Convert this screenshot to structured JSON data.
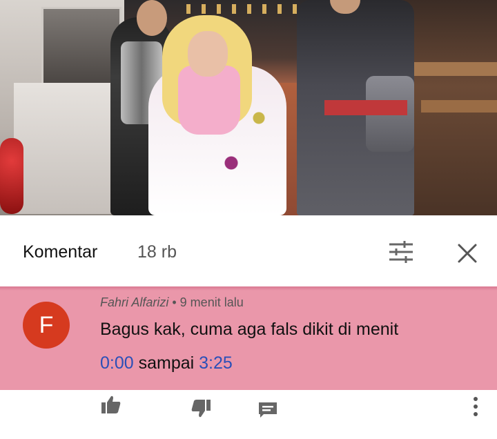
{
  "comments_panel": {
    "title": "Komentar",
    "count": "18 rb"
  },
  "comment": {
    "avatar_letter": "F",
    "avatar_color": "#d63a1f",
    "highlight_color": "#ea97aa",
    "author": "Fahri Alfarizi",
    "separator": " • ",
    "time": "9 menit lalu",
    "text_line1": "Bagus kak, cuma aga fals dikit di menit",
    "timestamp_start": "0:00",
    "text_middle": " sampai ",
    "timestamp_end": "3:25"
  },
  "actions": {
    "like_icon": "thumbs-up-icon",
    "dislike_icon": "thumbs-down-icon",
    "reply_icon": "reply-icon",
    "more_icon": "more-vertical-icon"
  }
}
